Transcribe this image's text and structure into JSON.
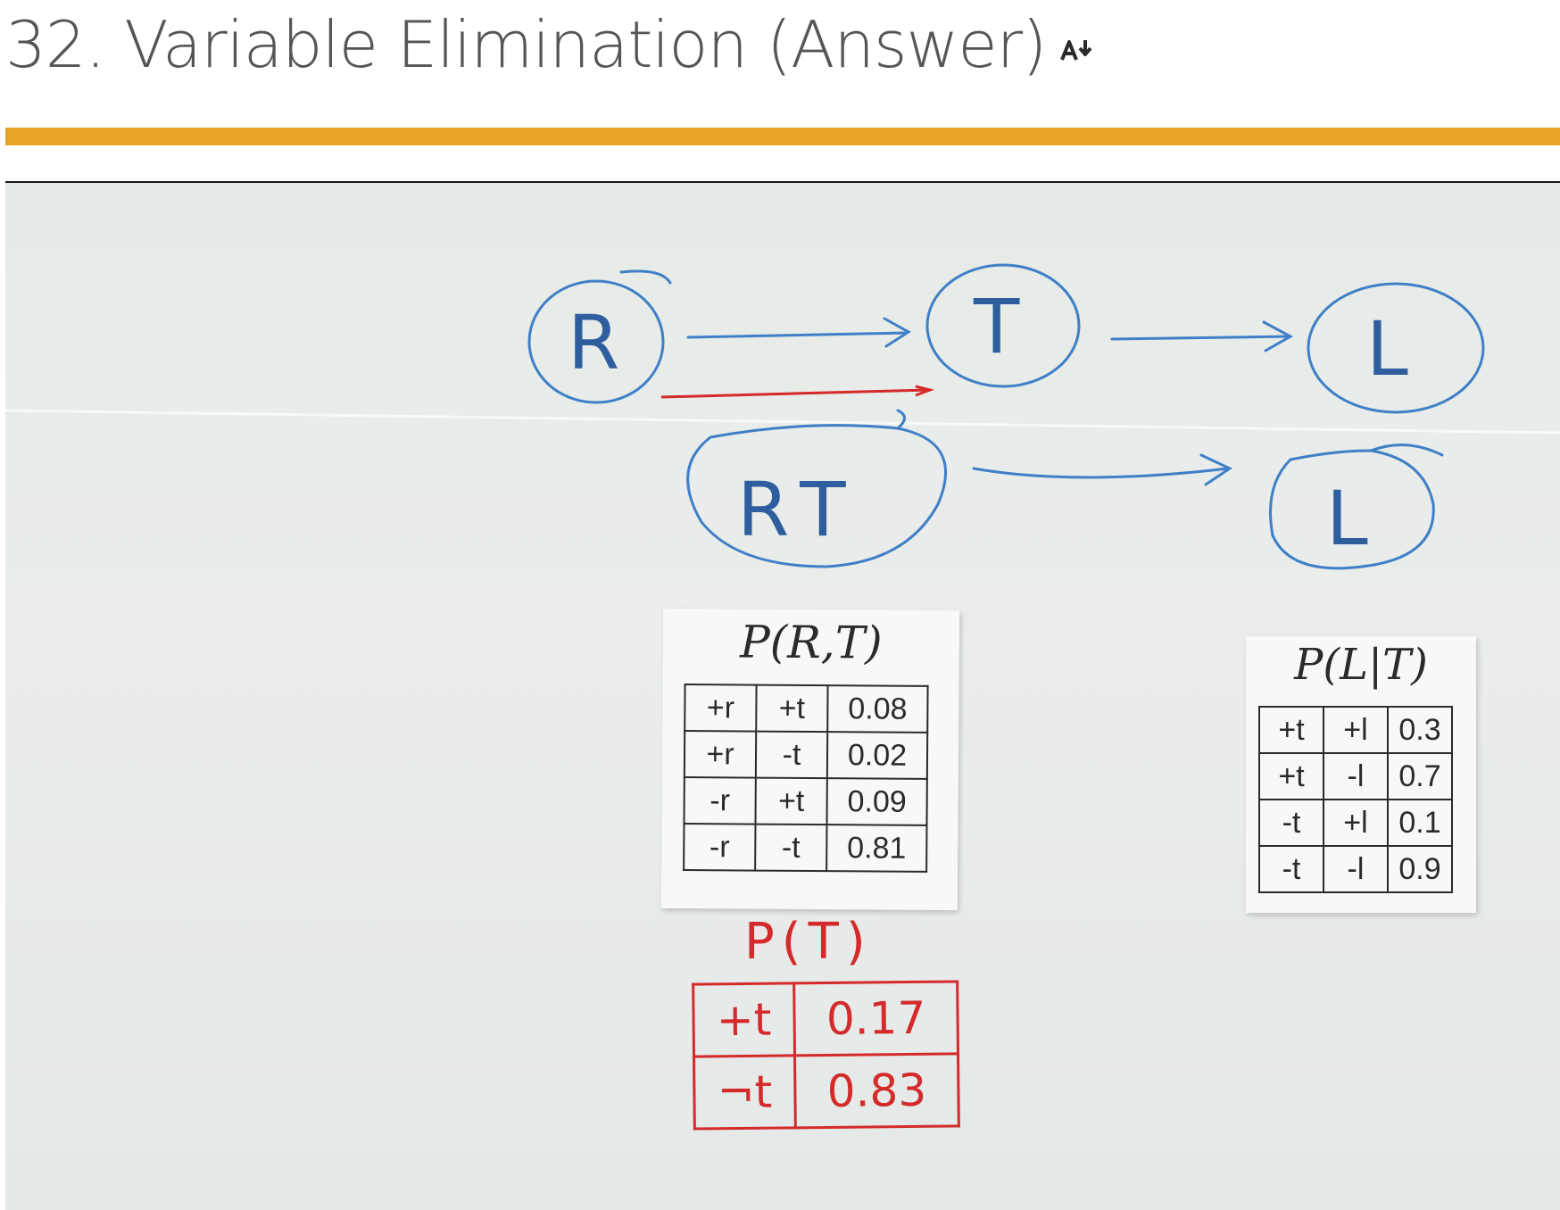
{
  "page": {
    "title": "32. Variable Elimination (Answer)",
    "title_icon": "text-size-icon"
  },
  "colors": {
    "accent_bar": "#e8a428",
    "marker_blue": "#3f7fc7",
    "marker_red": "#d42a2a",
    "title_text": "#555555"
  },
  "whiteboard": {
    "top_diagram": {
      "nodes": [
        "R",
        "T",
        "L"
      ]
    },
    "bottom_diagram": {
      "nodes": [
        "RT",
        "L"
      ]
    },
    "table_rt": {
      "title": "P(R,T)",
      "rows": [
        [
          "+r",
          "+t",
          "0.08"
        ],
        [
          "+r",
          "-t",
          "0.02"
        ],
        [
          "-r",
          "+t",
          "0.09"
        ],
        [
          "-r",
          "-t",
          "0.81"
        ]
      ]
    },
    "table_lt": {
      "title": "P(L|T)",
      "rows": [
        [
          "+t",
          "+l",
          "0.3"
        ],
        [
          "+t",
          "-l",
          "0.7"
        ],
        [
          "-t",
          "+l",
          "0.1"
        ],
        [
          "-t",
          "-l",
          "0.9"
        ]
      ]
    },
    "table_t": {
      "title": "P(T)",
      "rows": [
        [
          "+t",
          "0.17"
        ],
        [
          "¬t",
          "0.83"
        ]
      ]
    }
  }
}
